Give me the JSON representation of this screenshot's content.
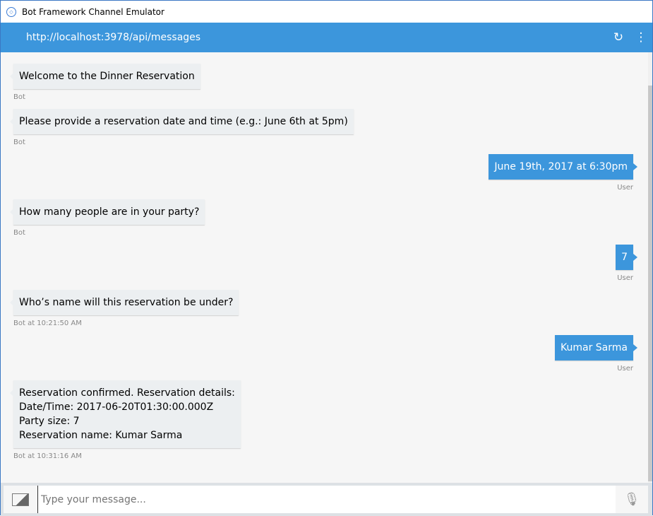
{
  "window": {
    "title": "Bot Framework Channel Emulator"
  },
  "header": {
    "url": "http://localhost:3978/api/messages",
    "refresh_icon": "↻",
    "menu_icon": "⋮"
  },
  "messages": [
    {
      "from": "bot",
      "text": "Welcome to the Dinner Reservation",
      "label": "Bot"
    },
    {
      "from": "bot",
      "text": "Please provide a reservation date and time (e.g.: June 6th at 5pm)",
      "label": "Bot"
    },
    {
      "from": "user",
      "text": "June 19th, 2017 at 6:30pm",
      "label": "User"
    },
    {
      "from": "bot",
      "text": "How many people are in your party?",
      "label": "Bot"
    },
    {
      "from": "user",
      "text": "7",
      "label": "User"
    },
    {
      "from": "bot",
      "text": "Who’s name will this reservation be under?",
      "label": "Bot at 10:21:50 AM"
    },
    {
      "from": "user",
      "text": "Kumar Sarma",
      "label": "User"
    },
    {
      "from": "bot",
      "lines": [
        "Reservation confirmed. Reservation details:",
        "Date/Time: 2017-06-20T01:30:00.000Z",
        "Party size: 7",
        "Reservation name: Kumar Sarma"
      ],
      "label": "Bot at 10:31:16 AM"
    }
  ],
  "input": {
    "placeholder": "Type your message...",
    "value": ""
  },
  "colors": {
    "accent": "#3c96dc",
    "bot_bubble": "#eceff1",
    "background": "#f6f6f6"
  }
}
